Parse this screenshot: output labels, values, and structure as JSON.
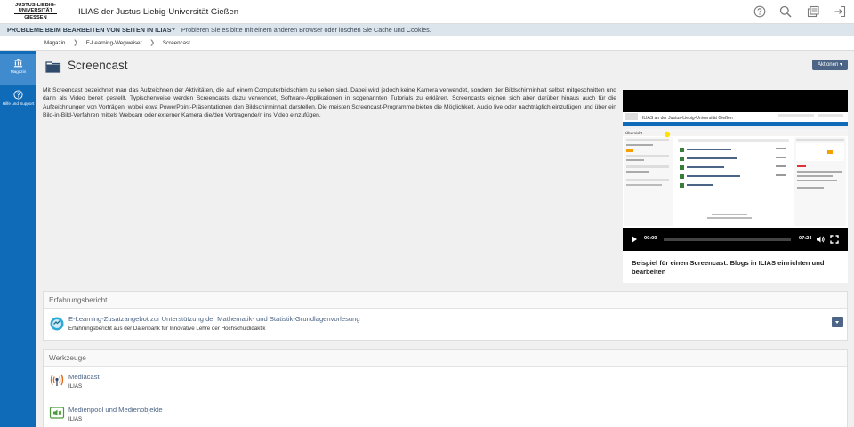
{
  "header": {
    "logo_lines": [
      "JUSTUS-LIEBIG-",
      "UNIVERSITÄT",
      "GIESSEN"
    ],
    "app_title": "ILIAS der Justus-Liebig-Universität Gießen",
    "icons": [
      "help-icon",
      "search-icon",
      "notifications-icon",
      "logout-icon"
    ]
  },
  "notice": {
    "strong": "PROBLEME BEIM BEARBEITEN VON SEITEN IN ILIAS?",
    "text": "Probieren Sie es bitte mit einem anderen Browser oder löschen Sie Cache und Cookies."
  },
  "breadcrumb": [
    "Magazin",
    "E-Learning-Wegweiser",
    "Screencast"
  ],
  "sidebar": {
    "items": [
      {
        "label": "Magazin",
        "icon": "bank-icon",
        "active": true
      },
      {
        "label": "Hilfe und Support",
        "icon": "help-icon",
        "active": false
      }
    ]
  },
  "main": {
    "title": "Screencast",
    "actions_label": "Aktionen",
    "description": "Mit Screencast bezeichnet man das Aufzeichnen der Aktivitäten, die auf einem Computerbildschirm zu sehen sind. Dabei wird jedoch keine Kamera verwendet, sondern der Bildschirminhalt selbst mitgeschnitten und dann als Video bereit gestellt. Typischerweise werden Screencasts dazu verwendet, Software-Applikationen in sogenannten Tutorials zu erklären. Screencasts eignen sich aber darüber hinaus auch für die Aufzeichnungen von Vorträgen, wobei etwa PowerPoint-Präsentationen den Bildschirminhalt darstellen. Die meisten Screencast-Programme bieten die Möglichkeit, Audio live oder nachträglich einzufügen und über ein Bild-in-Bild-Verfahren mittels Webcam oder externer Kamera die/den Vortragende/n ins Video einzufügen.",
    "video": {
      "current_time": "00:00",
      "duration": "07:24",
      "progress": 0,
      "caption": "Beispiel für einen Screencast: Blogs in ILIAS einrichten und bearbeiten",
      "screenshot_title": "ILIAS an der Justus-Liebig-Universität Gießen",
      "screenshot_tab": "Übersicht"
    }
  },
  "sections": [
    {
      "heading": "Erfahrungsbericht",
      "items": [
        {
          "title": "E-Learning-Zusatzangebot zur Unterstützung der Mathematik- und Statistik-Grundlagenvorlesung",
          "subtitle": "Erfahrungsbericht aus der Datenbank für Innovative Lehre der Hochschuldidaktik",
          "icon": "link-icon"
        }
      ]
    },
    {
      "heading": "Werkzeuge",
      "items": [
        {
          "title": "Mediacast",
          "subtitle": "ILIAS",
          "icon": "mediacast-icon"
        },
        {
          "title": "Medienpool und Medienobjekte",
          "subtitle": "ILIAS",
          "icon": "mediapool-icon"
        }
      ]
    }
  ]
}
